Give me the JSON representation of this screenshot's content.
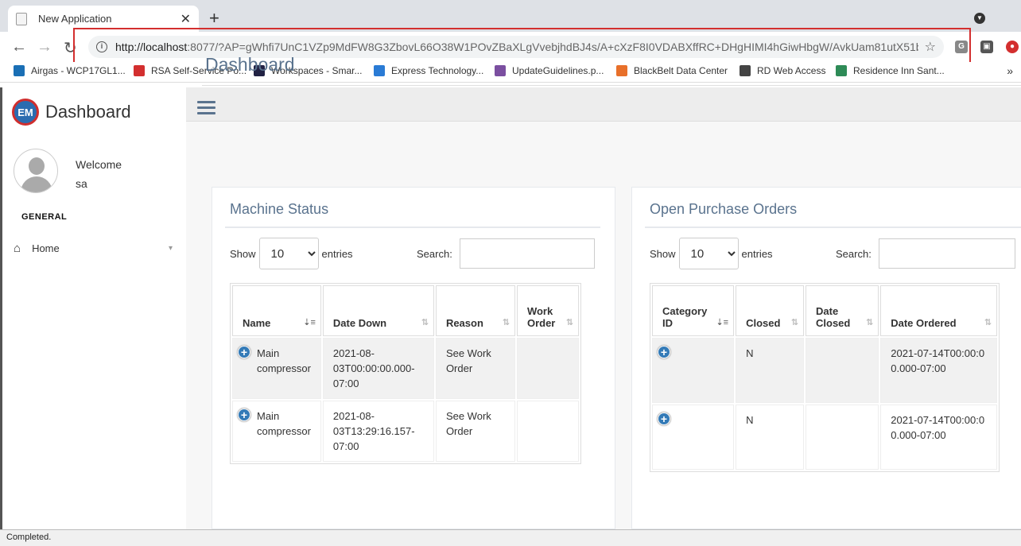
{
  "browser": {
    "tab_title": "New Application",
    "url_host": "http://localhost",
    "url_rest": ":8077/?AP=gWhfi7UnC1VZp9MdFW8G3ZbovL66O38W1POvZBaXLgVvebjhdBJ4s/A+cXzF8I0VDABXffRC+DHgHIMI4hGiwHbgW/AvkUam81utX51b...",
    "bookmarks": [
      {
        "label": "Airgas - WCP17GL1...",
        "color": "#1a6fb5"
      },
      {
        "label": "RSA Self-Service Po...",
        "color": "#d32f2f"
      },
      {
        "label": "Workspaces - Smar...",
        "color": "#222244"
      },
      {
        "label": "Express Technology...",
        "color": "#2a7bd5"
      },
      {
        "label": "UpdateGuidelines.p...",
        "color": "#7b4fa0"
      },
      {
        "label": "BlackBelt Data Center",
        "color": "#e8702a"
      },
      {
        "label": "RD Web Access",
        "color": "#444444"
      },
      {
        "label": "Residence Inn Sant...",
        "color": "#2e8b57"
      }
    ],
    "status": "Completed."
  },
  "sidebar": {
    "brand_logo": "EM",
    "brand_title": "Dashboard",
    "welcome": "Welcome",
    "username": "sa",
    "section": "GENERAL",
    "nav_home": "Home"
  },
  "page": {
    "title": "Dashboard"
  },
  "machine_status": {
    "title": "Machine Status",
    "show_label": "Show",
    "entries_value": "10",
    "entries_label": "entries",
    "search_label": "Search:",
    "columns": [
      "Name",
      "Date Down",
      "Reason",
      "Work Order"
    ],
    "rows": [
      {
        "name": "Main compressor",
        "date_down": "2021-08-03T00:00:00.000-07:00",
        "reason": "See Work Order",
        "work_order": ""
      },
      {
        "name": "Main compressor",
        "date_down": "2021-08-03T13:29:16.157-07:00",
        "reason": "See Work Order",
        "work_order": ""
      }
    ]
  },
  "open_po": {
    "title": "Open Purchase Orders",
    "show_label": "Show",
    "entries_value": "10",
    "entries_label": "entries",
    "search_label": "Search:",
    "columns": [
      "Category ID",
      "Closed",
      "Date Closed",
      "Date Ordered"
    ],
    "rows": [
      {
        "category_id": "",
        "closed": "N",
        "date_closed": "",
        "date_ordered": "2021-07-14T00:00:00.000-07:00"
      },
      {
        "category_id": "",
        "closed": "N",
        "date_closed": "",
        "date_ordered": "2021-07-14T00:00:00.000-07:00"
      }
    ]
  }
}
